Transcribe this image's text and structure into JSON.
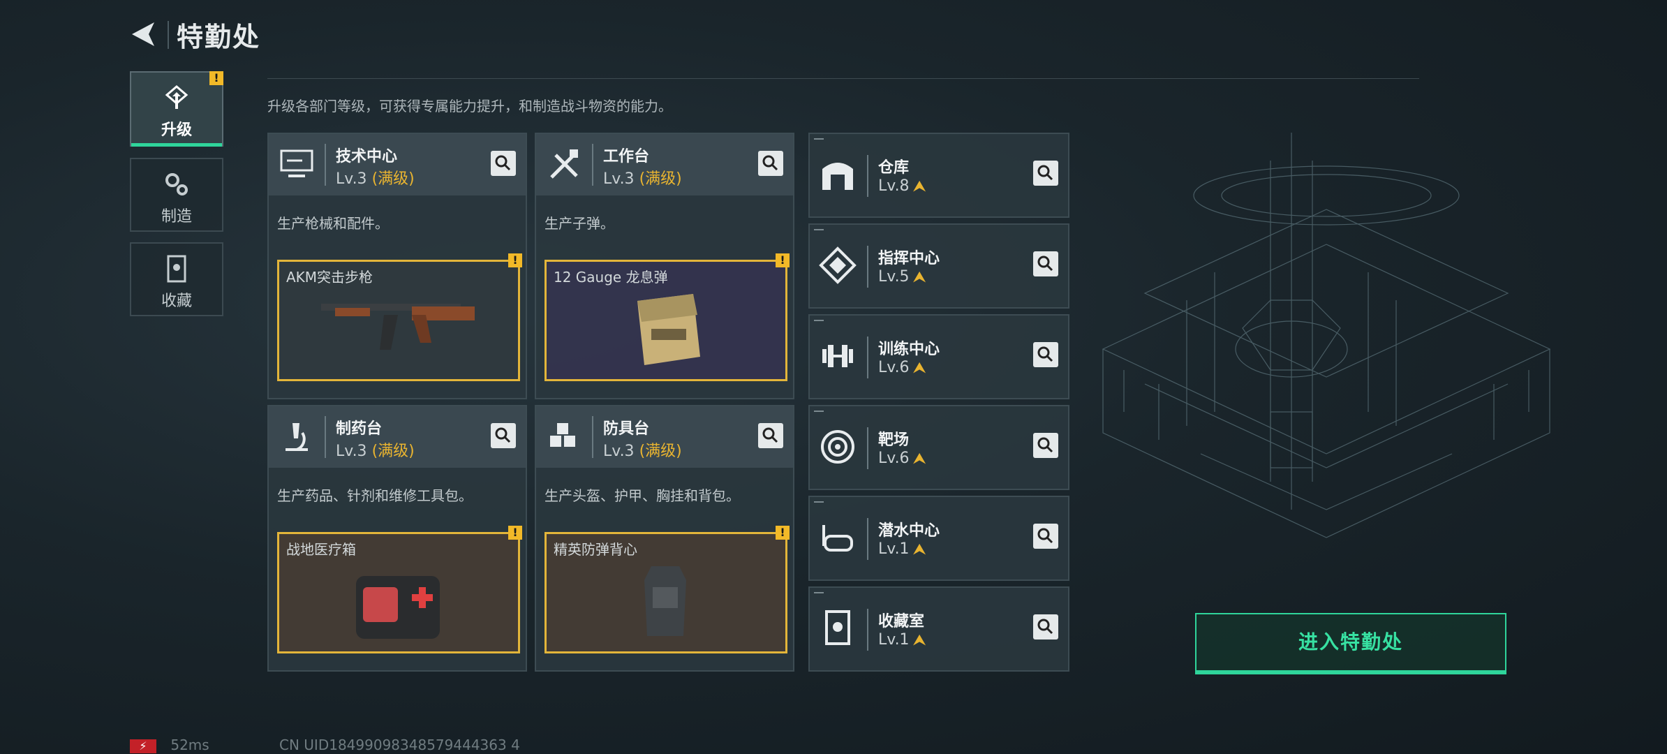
{
  "header": {
    "title": "特勤处"
  },
  "tabs": [
    {
      "label": "升级",
      "active": true,
      "badge": "!"
    },
    {
      "label": "制造",
      "active": false
    },
    {
      "label": "收藏",
      "active": false
    }
  ],
  "description": "升级各部门等级，可获得专属能力提升，和制造战斗物资的能力。",
  "facilities": [
    {
      "name": "技术中心",
      "level": "Lv.3",
      "max": "(满级)",
      "desc": "生产枪械和配件。",
      "item": "AKM突击步枪",
      "icon": "monitor-icon",
      "item_badge": "!"
    },
    {
      "name": "工作台",
      "level": "Lv.3",
      "max": "(满级)",
      "desc": "生产子弹。",
      "item": "12 Gauge 龙息弹",
      "icon": "tools-icon",
      "item_badge": "!"
    },
    {
      "name": "制药台",
      "level": "Lv.3",
      "max": "(满级)",
      "desc": "生产药品、针剂和维修工具包。",
      "item": "战地医疗箱",
      "icon": "microscope-icon",
      "item_badge": "!"
    },
    {
      "name": "防具台",
      "level": "Lv.3",
      "max": "(满级)",
      "desc": "生产头盔、护甲、胸挂和背包。",
      "item": "精英防弹背心",
      "icon": "armor-blocks-icon",
      "item_badge": "!"
    }
  ],
  "side_facilities": [
    {
      "name": "仓库",
      "level": "Lv.8",
      "icon": "warehouse-icon"
    },
    {
      "name": "指挥中心",
      "level": "Lv.5",
      "icon": "command-icon"
    },
    {
      "name": "训练中心",
      "level": "Lv.6",
      "icon": "dumbbell-icon"
    },
    {
      "name": "靶场",
      "level": "Lv.6",
      "icon": "target-icon"
    },
    {
      "name": "潜水中心",
      "level": "Lv.1",
      "icon": "diving-mask-icon"
    },
    {
      "name": "收藏室",
      "level": "Lv.1",
      "icon": "collection-icon"
    }
  ],
  "enter_button": "进入特勤处",
  "status": {
    "battery": "⚡",
    "ping": "52ms",
    "uid": "CN UID18499098348579444363 4"
  },
  "colors": {
    "accent": "#2fd59b",
    "gold": "#e9b430",
    "badge": "#f2b928"
  }
}
